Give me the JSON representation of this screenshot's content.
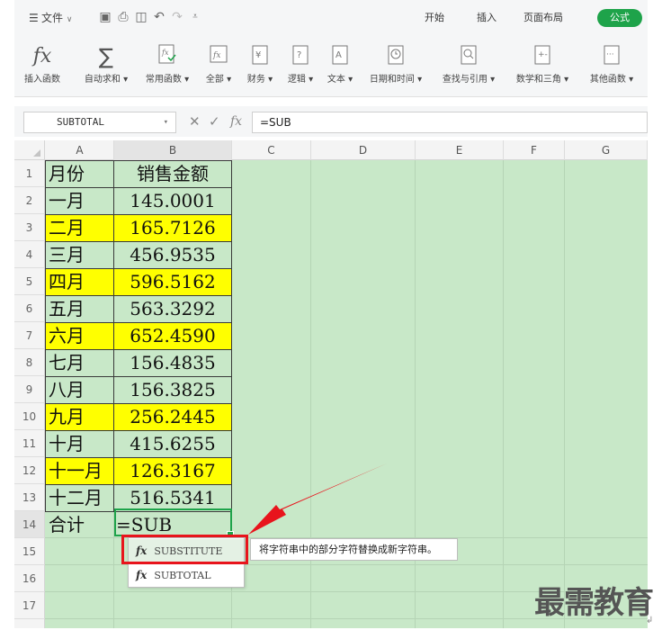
{
  "menubar": {
    "menu_label": "文件",
    "tabs": [
      {
        "label": "开始"
      },
      {
        "label": "插入"
      },
      {
        "label": "页面布局"
      },
      {
        "label": "公式",
        "active": true
      }
    ]
  },
  "ribbon": {
    "buttons": [
      {
        "label": "插入函数"
      },
      {
        "label": "自动求和"
      },
      {
        "label": "常用函数"
      },
      {
        "label": "全部"
      },
      {
        "label": "财务"
      },
      {
        "label": "逻辑"
      },
      {
        "label": "文本"
      },
      {
        "label": "日期和时间"
      },
      {
        "label": "查找与引用"
      },
      {
        "label": "数学和三角"
      },
      {
        "label": "其他函数"
      }
    ]
  },
  "formula_bar": {
    "name_box": "SUBTOTAL",
    "formula": "=SUB"
  },
  "sheet": {
    "columns": [
      "A",
      "B",
      "C",
      "D",
      "E",
      "F",
      "G"
    ],
    "rows": [
      "1",
      "2",
      "3",
      "4",
      "5",
      "6",
      "7",
      "8",
      "9",
      "10",
      "11",
      "12",
      "13",
      "14",
      "15",
      "16",
      "17"
    ],
    "data": [
      {
        "a": "月份",
        "b": "销售金额",
        "highlight": false
      },
      {
        "a": "一月",
        "b": "145.0001",
        "highlight": false
      },
      {
        "a": "二月",
        "b": "165.7126",
        "highlight": true
      },
      {
        "a": "三月",
        "b": "456.9535",
        "highlight": false
      },
      {
        "a": "四月",
        "b": "596.5162",
        "highlight": true
      },
      {
        "a": "五月",
        "b": "563.3292",
        "highlight": false
      },
      {
        "a": "六月",
        "b": "652.4590",
        "highlight": true
      },
      {
        "a": "七月",
        "b": "156.4835",
        "highlight": false
      },
      {
        "a": "八月",
        "b": "156.3825",
        "highlight": false
      },
      {
        "a": "九月",
        "b": "256.2445",
        "highlight": true
      },
      {
        "a": "十月",
        "b": "415.6255",
        "highlight": false
      },
      {
        "a": "十一月",
        "b": "126.3167",
        "highlight": true
      },
      {
        "a": "十二月",
        "b": "516.5341",
        "highlight": false
      },
      {
        "a": "合计",
        "b": "=SUB",
        "highlight": false
      }
    ],
    "highlight_color": "#ffff00",
    "background_color": "#c8e8c8"
  },
  "autocomplete": {
    "items": [
      {
        "icon": "fx-icon",
        "label": "SUBSTITUTE"
      },
      {
        "icon": "fx-icon",
        "label": "SUBTOTAL"
      }
    ],
    "tooltip": "将字符串中的部分字符替换成新字符串。"
  },
  "annotation": {
    "highlight_color": "#e8141c"
  },
  "watermark": "最需教育",
  "colors": {
    "accent": "#1ea34a"
  }
}
